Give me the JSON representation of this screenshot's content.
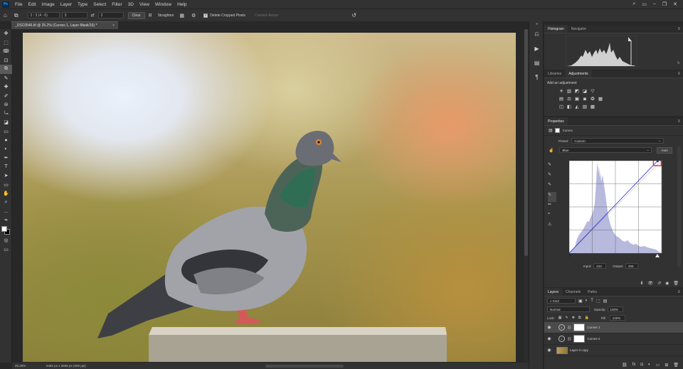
{
  "menu": {
    "logo": "Ps",
    "items": [
      "File",
      "Edit",
      "Image",
      "Layer",
      "Type",
      "Select",
      "Filter",
      "3D",
      "View",
      "Window",
      "Help"
    ]
  },
  "options_bar": {
    "ratio_value": "2 : 3 (4 : 6)",
    "width_value": "3",
    "height_value": "2",
    "clear_label": "Clear",
    "straighten_label": "Straighten",
    "delete_cropped_label": "Delete Cropped Pixels",
    "content_aware_label": "Content-Aware"
  },
  "document": {
    "tab_title": "_DSC0546.tif @ 25.2% (Curves 1, Layer Mask/16) *",
    "close_glyph": "×",
    "zoom": "25.28%",
    "dimensions": "9481 px x 3696 px (300 ppi)"
  },
  "histogram": {
    "tabs": [
      "Histogram",
      "Navigator"
    ]
  },
  "adjustments": {
    "tabs": [
      "Libraries",
      "Adjustments"
    ],
    "add_label": "Add an adjustment",
    "rows": [
      [
        "☀",
        "▥",
        "◩",
        "◪",
        "▽"
      ],
      [
        "▤",
        "⚖",
        "▣",
        "◙",
        "❂",
        "▦"
      ],
      [
        "◫",
        "◧",
        "◭",
        "▨",
        "▩"
      ]
    ]
  },
  "properties": {
    "title": "Properties",
    "layer_type": "Curves",
    "preset_label": "Preset:",
    "preset_value": "Custom",
    "channel_value": "Blue",
    "auto_label": "Auto",
    "input_label": "Input:",
    "input_value": "244",
    "output_label": "Output:",
    "output_value": "255",
    "curve_points": {
      "input": [
        0,
        244
      ],
      "output": [
        0,
        255
      ]
    }
  },
  "layers": {
    "tabs": [
      "Layers",
      "Channels",
      "Paths"
    ],
    "kind_label": "Kind",
    "blend_mode": "Normal",
    "opacity_label": "Opacity:",
    "opacity_value": "100%",
    "lock_label": "Lock:",
    "fill_label": "Fill:",
    "fill_value": "100%",
    "items": [
      {
        "name": "Curves 1",
        "selected": true
      },
      {
        "name": "Curves 2",
        "selected": false
      },
      {
        "name": "Layer 0 copy",
        "selected": false
      }
    ]
  },
  "colors": {
    "accent": "#31a8ff",
    "curve_highlight": "#e03030",
    "histogram_fill": "#b7b9dd"
  }
}
